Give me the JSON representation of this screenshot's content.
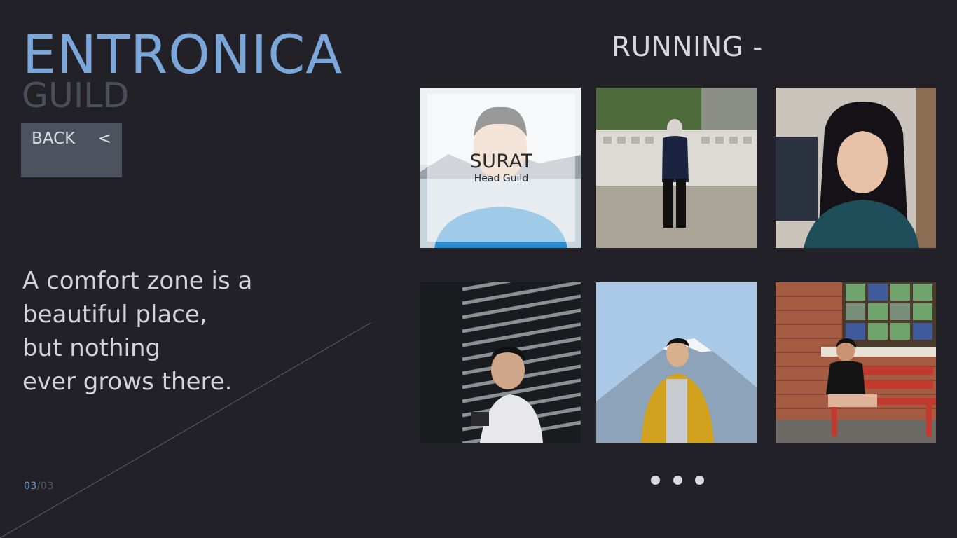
{
  "brand": {
    "title": "ENTRONICA",
    "subtitle": "GUILD"
  },
  "back_button": {
    "label": "BACK",
    "icon": "<"
  },
  "quote_lines": [
    "A comfort zone is a",
    "beautiful place,",
    "but nothing",
    "ever grows there."
  ],
  "pager": {
    "current": "03",
    "separator": "/",
    "total": "03"
  },
  "section": {
    "heading": "RUNNING -"
  },
  "members": [
    {
      "name": "SURAT",
      "role": "Head Guild"
    }
  ],
  "carousel": {
    "dot_count": 3
  },
  "colors": {
    "background": "#222127",
    "accent": "#7ba6d9",
    "button": "#4c535e"
  }
}
